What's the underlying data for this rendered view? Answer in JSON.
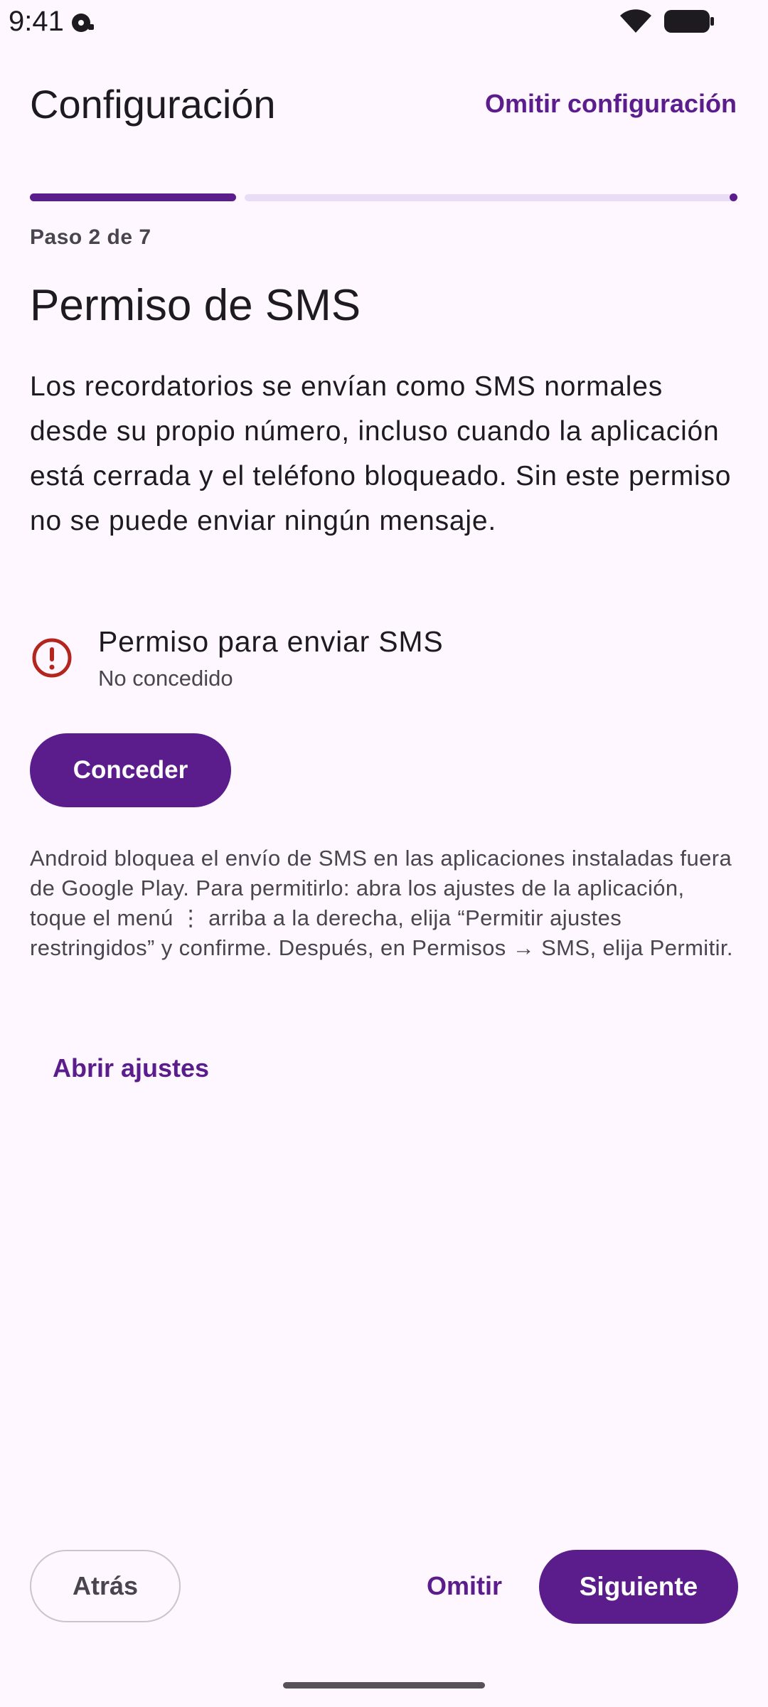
{
  "status_bar": {
    "time": "9:41",
    "icons": [
      "notification-icon",
      "wifi-icon",
      "battery-icon"
    ]
  },
  "header": {
    "title": "Configuración",
    "skip_setup_label": "Omitir configuración"
  },
  "progress": {
    "step_label": "Paso 2 de 7",
    "current_step": 2,
    "total_steps": 7
  },
  "section": {
    "title": "Permiso de SMS",
    "body": "Los recordatorios se envían como SMS normales desde su propio número, incluso cuando la aplicación está cerrada y el teléfono bloqueado. Sin este permiso no se puede enviar ningún mensaje."
  },
  "permission": {
    "icon": "error-icon",
    "title": "Permiso para enviar SMS",
    "status": "No concedido",
    "grant_label": "Conceder"
  },
  "info": {
    "text": "Android bloquea el envío de SMS en las aplicaciones instaladas fuera de Google Play. Para permitirlo: abra los ajustes de la aplicación, toque el menú ⋮ arriba a la derecha, elija “Permitir ajustes restringidos” y confirme. Después, en Permisos → SMS, elija Permitir.",
    "open_settings_label": "Abrir ajustes"
  },
  "footer": {
    "back_label": "Atrás",
    "skip_label": "Omitir",
    "next_label": "Siguiente"
  },
  "colors": {
    "background": "#FEF7FF",
    "primary": "#5B1C8C",
    "track": "#E9DDF5",
    "error": "#B3261E",
    "text": "#1D1B20",
    "text_secondary": "#49454F"
  }
}
